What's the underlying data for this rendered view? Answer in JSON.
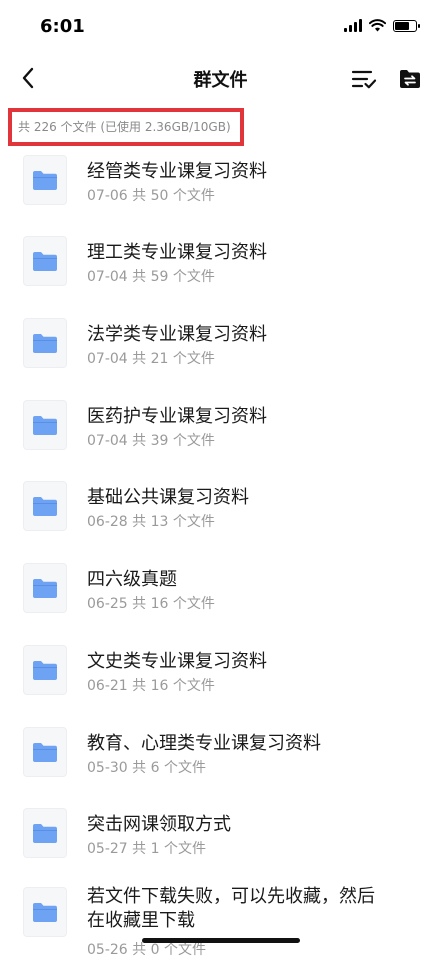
{
  "status_bar": {
    "time": "6:01",
    "battery_level": 0.8
  },
  "nav": {
    "title": "群文件"
  },
  "icons": {
    "back": "chevron-left-icon",
    "multiselect": "list-check-icon",
    "transfer": "folder-transfer-icon",
    "folder": "folder-icon"
  },
  "colors": {
    "folder": "#6ea2f2",
    "highlight_box": "#e0353a"
  },
  "summary": {
    "text": "共 226 个文件 (已使用 2.36GB/10GB)"
  },
  "files": [
    {
      "name": "经管类专业课复习资料",
      "meta": "07-06 共 50 个文件"
    },
    {
      "name": "理工类专业课复习资料",
      "meta": "07-04 共 59 个文件"
    },
    {
      "name": "法学类专业课复习资料",
      "meta": "07-04 共 21 个文件"
    },
    {
      "name": "医药护专业课复习资料",
      "meta": "07-04 共 39 个文件"
    },
    {
      "name": "基础公共课复习资料",
      "meta": "06-28 共 13 个文件"
    },
    {
      "name": "四六级真题",
      "meta": "06-25 共 16 个文件"
    },
    {
      "name": "文史类专业课复习资料",
      "meta": "06-21 共 16 个文件"
    },
    {
      "name": "教育、心理类专业课复习资料",
      "meta": "05-30 共 6 个文件"
    },
    {
      "name": "突击网课领取方式",
      "meta": "05-27 共 1 个文件"
    },
    {
      "name": "若文件下载失败，可以先收藏，然后在收藏里下载",
      "meta": "05-26 共 0 个文件"
    }
  ]
}
